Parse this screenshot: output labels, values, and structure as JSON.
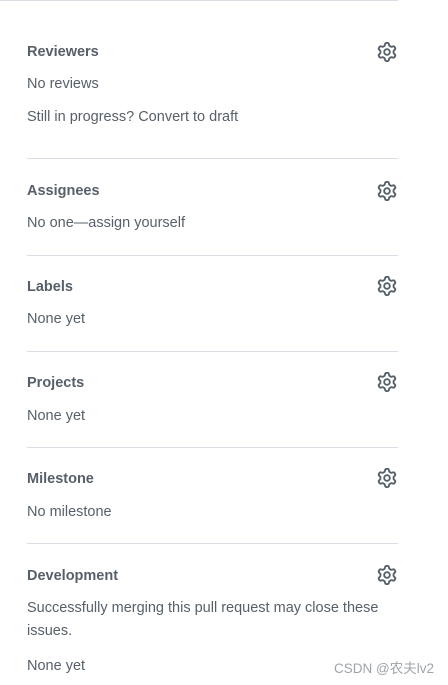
{
  "reviewers": {
    "title": "Reviewers",
    "empty": "No reviews",
    "draft_text": "Still in progress? Convert to draft",
    "icon": "gear-icon"
  },
  "assignees": {
    "title": "Assignees",
    "empty": "No one—assign yourself",
    "icon": "gear-icon"
  },
  "labels": {
    "title": "Labels",
    "empty": "None yet",
    "icon": "gear-icon"
  },
  "projects": {
    "title": "Projects",
    "empty": "None yet",
    "icon": "gear-icon"
  },
  "milestone": {
    "title": "Milestone",
    "empty": "No milestone",
    "icon": "gear-icon"
  },
  "development": {
    "title": "Development",
    "note": "Successfully merging this pull request may close these issues.",
    "empty": "None yet",
    "icon": "gear-icon"
  },
  "watermark": "CSDN @农夫lv2",
  "colors": {
    "text_muted": "#57606a",
    "divider": "#d8dee4",
    "icon": "#57606a"
  }
}
